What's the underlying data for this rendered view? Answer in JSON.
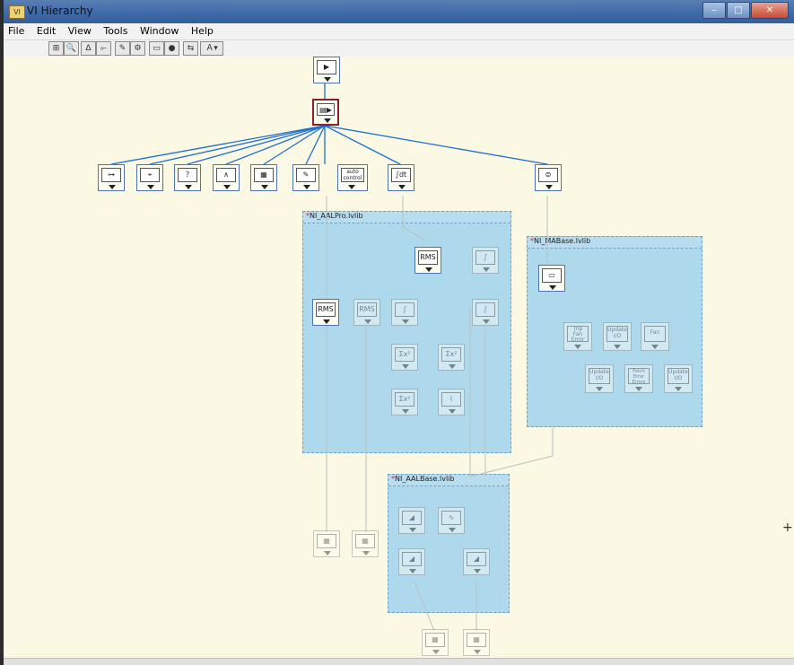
{
  "window": {
    "title": "VI Hierarchy",
    "minimize": "‒",
    "maximize": "□",
    "close": "✕",
    "icon": "vi-hierarchy-icon"
  },
  "menu": [
    "File",
    "Edit",
    "View",
    "Tools",
    "Window",
    "Help"
  ],
  "toolbar": {
    "buttons": [
      "redo-layout-icon",
      "zoom-icon",
      "show-all-vis-icon",
      "include-vi-lib-icon",
      "include-globals-icon",
      "include-typedefs-icon",
      "show-hierarchy-icon",
      "full-vi-path-icon",
      "horizontal-layout-icon",
      "label-options-icon"
    ],
    "glyphs": [
      "⊞",
      "🔍",
      "ᐃ",
      "⟜",
      "✎",
      "⚙",
      "▭",
      "●",
      "⇆",
      "Ａ▾"
    ]
  },
  "nodes": {
    "main_vi": "▶",
    "top_vi": "▤▶",
    "child_1": "⊶",
    "child_2": "⌖",
    "child_3": "?",
    "child_4": "∧",
    "child_5": "▦",
    "child_6": "✎",
    "child_7": "auto control",
    "child_8": "∫dt",
    "child_9": "⊜",
    "rms_main": "RMS",
    "rms_2": "RMS",
    "rms_3": "RMS",
    "integral_1": "∫",
    "integral_2": "∫",
    "integral_3": "∫",
    "calc_1": "Σx²",
    "calc_2": "Σx²",
    "calc_3": "Σx²",
    "calc_4": "Σx²",
    "fn_1": "⌇",
    "ma_1": "▭",
    "ma_trip": "Trip Fan Error",
    "ma_update_1": "Update I/O",
    "ma_fan": "Fan",
    "ma_update_2": "Update I/O",
    "ma_fetch": "Fetch Error Errors",
    "ma_update_3": "Update I/O",
    "base_1": "◢",
    "base_2": "∿",
    "base_3": "◢",
    "base_4": "◢",
    "leaf_1": "▦",
    "leaf_2": "▦",
    "leaf_3": "▦",
    "leaf_4": "▦"
  },
  "libraries": {
    "aal_pro": {
      "mark": "*",
      "name": "NI_AALPro.lvlib"
    },
    "ma_base": {
      "mark": "*",
      "name": "NI_MABase.lvlib"
    },
    "aal_base": {
      "mark": "*",
      "name": "NI_AALBase.lvlib"
    }
  },
  "colors": {
    "wire": "#1e6fd0",
    "wire_dim": "#b9bfbd",
    "library_fill": "#aed8ec",
    "selected_border": "#8a1f2a",
    "canvas": "#fbf8e3"
  }
}
